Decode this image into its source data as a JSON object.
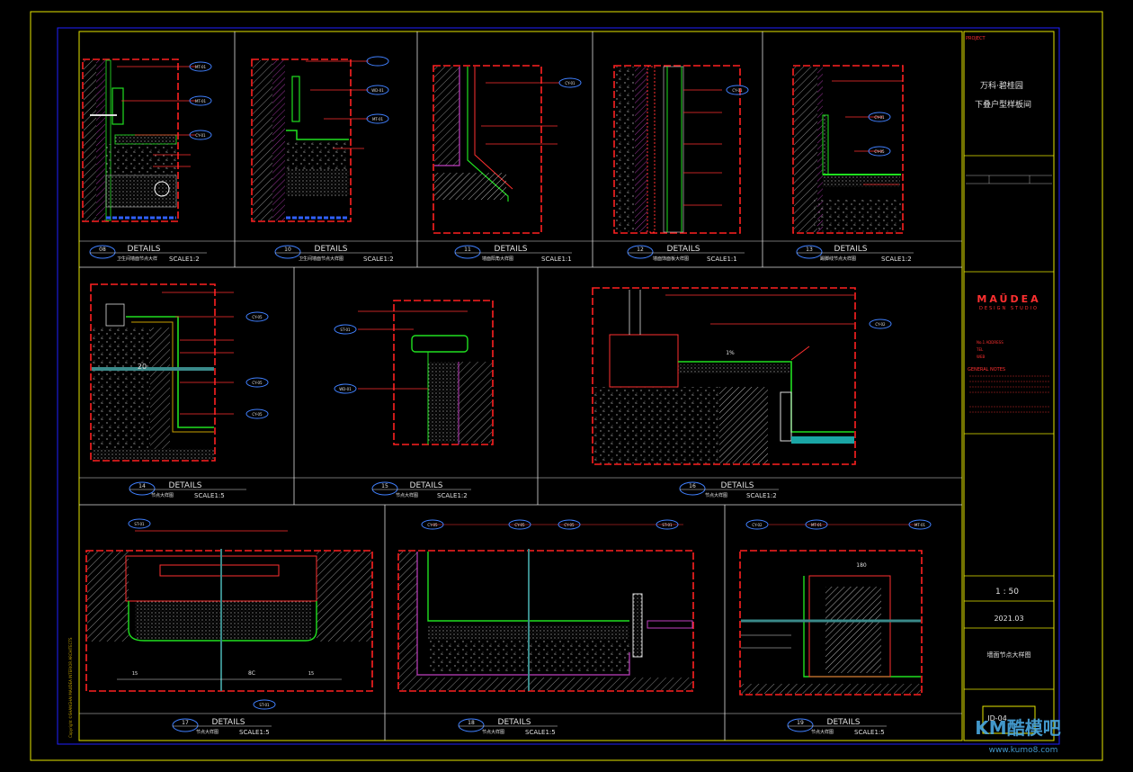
{
  "title_block": {
    "project_label": "PROJECT",
    "project_name_line1": "万科·碧桂园",
    "project_name_line2": "下叠户型样板间",
    "company_line1": "MAÜDEA",
    "company_line2": "DESIGN STUDIO",
    "general_notes_label": "GENERAL NOTES",
    "scale_value": "1 : 50",
    "date_value": "2021.03",
    "drawing_title": "墙面节点大样图",
    "drawing_no": "ID-04"
  },
  "details": [
    {
      "num": "08",
      "title": "DETAILS",
      "sub": "卫生间墙面节点大样",
      "scale": "SCALE1:2"
    },
    {
      "num": "10",
      "title": "DETAILS",
      "sub": "卫生间墙面节点大样图",
      "scale": "SCALE1:2"
    },
    {
      "num": "11",
      "title": "DETAILS",
      "sub": "墙面阳角大样图",
      "scale": "SCALE1:1"
    },
    {
      "num": "12",
      "title": "DETAILS",
      "sub": "墙面饰面板大样图",
      "scale": "SCALE1:1"
    },
    {
      "num": "13",
      "title": "DETAILS",
      "sub": "踢脚线节点大样图",
      "scale": "SCALE1:2"
    },
    {
      "num": "14",
      "title": "DETAILS",
      "sub": "节点大样图",
      "scale": "SCALE1:5"
    },
    {
      "num": "15",
      "title": "DETAILS",
      "sub": "节点大样图",
      "scale": "SCALE1:2"
    },
    {
      "num": "16",
      "title": "DETAILS",
      "sub": "节点大样图",
      "scale": "SCALE1:2"
    },
    {
      "num": "17",
      "title": "DETAILS",
      "sub": "节点大样图",
      "scale": "SCALE1:5"
    },
    {
      "num": "18",
      "title": "DETAILS",
      "sub": "节点大样图",
      "scale": "SCALE1:5"
    },
    {
      "num": "19",
      "title": "DETAILS",
      "sub": "节点大样图",
      "scale": "SCALE1:5"
    }
  ],
  "tags": {
    "mt01": "MT-01",
    "st01": "ST-01",
    "cy01": "CY-01",
    "cy02": "CY-02",
    "cy05": "CY-05",
    "wd01": "WD-01"
  },
  "dims": {
    "d180": "180",
    "d1pct": "1%",
    "d15": "15",
    "d20": "20",
    "d8c": "8C"
  },
  "watermark": {
    "brand": "KM酷模吧",
    "url": "www.kumo8.com"
  },
  "copyright": "Copyright ©SHANGHAI MAUDEA INTERIOR ARCHITECTS"
}
